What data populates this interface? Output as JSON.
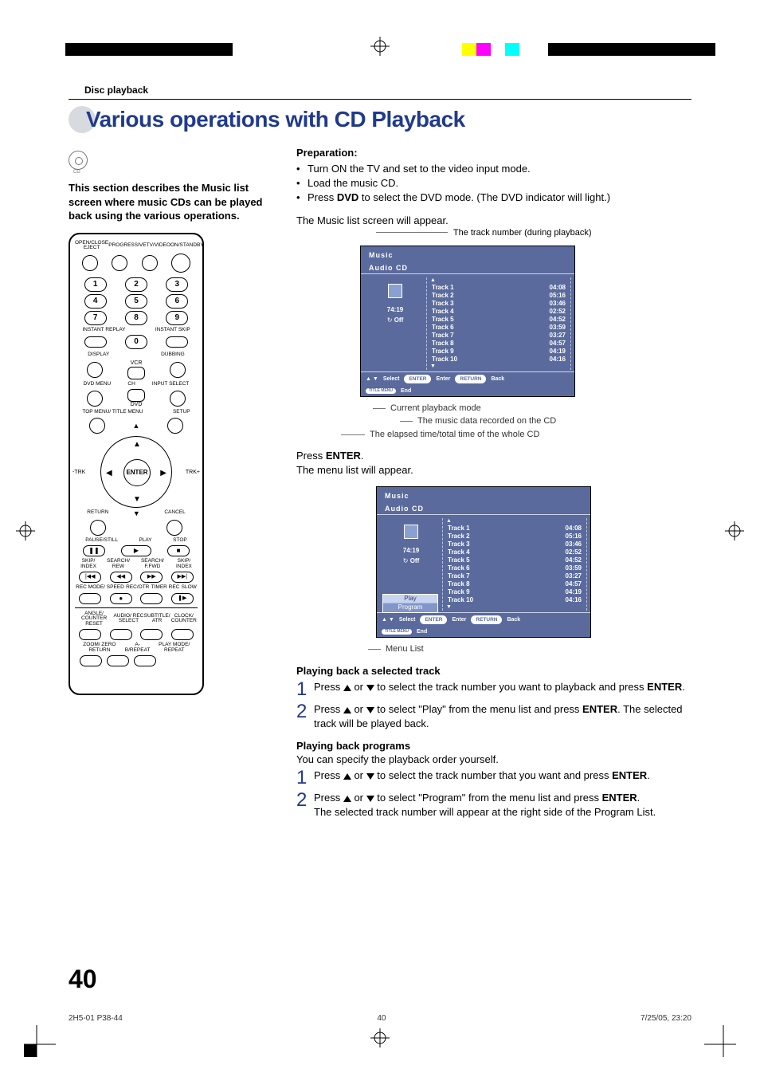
{
  "section_header": "Disc playback",
  "page_title": "Various operations with CD Playback",
  "cd_label": "CD",
  "intro": "This section describes the Music list screen where music CDs can be played back using the various operations.",
  "preparation": {
    "heading": "Preparation:",
    "bullets": [
      "Turn ON the TV and set to the video input mode.",
      "Load the music CD.",
      "Press DVD to select the DVD mode. (The DVD indicator will light.)"
    ],
    "bold_in_b3": "DVD"
  },
  "para_after_prep": "The Music list screen will appear.",
  "track_callout": "The track number (during playback)",
  "osd1": {
    "title": "Music",
    "subtitle": "Audio CD",
    "total": "74:19",
    "mode_label": "Off",
    "tracks": [
      {
        "n": "Track 1",
        "t": "04:08"
      },
      {
        "n": "Track 2",
        "t": "05:16"
      },
      {
        "n": "Track 3",
        "t": "03:46"
      },
      {
        "n": "Track 4",
        "t": "02:52"
      },
      {
        "n": "Track 5",
        "t": "04:52"
      },
      {
        "n": "Track 6",
        "t": "03:59"
      },
      {
        "n": "Track 7",
        "t": "03:27"
      },
      {
        "n": "Track 8",
        "t": "04:57"
      },
      {
        "n": "Track 9",
        "t": "04:19"
      },
      {
        "n": "Track 10",
        "t": "04:16"
      }
    ],
    "hints": {
      "select": "Select",
      "enter": "ENTER",
      "enter_lbl": "Enter",
      "return": "RETURN",
      "back": "Back",
      "title": "TITLE MENU",
      "end": "End"
    }
  },
  "callouts1": {
    "a": "Current playback mode",
    "b": "The music data recorded on the CD",
    "c": "The elapsed time/total time of the whole CD"
  },
  "press_enter_lead": "Press ",
  "press_enter_bold": "ENTER",
  "press_enter_tail": ".",
  "menu_will_appear": "The menu list will appear.",
  "osd2": {
    "menu_items": [
      "Play",
      "Program"
    ]
  },
  "menu_list_label": "Menu List",
  "sec_a": {
    "heading": "Playing back a selected track",
    "step1_a": "Press ",
    "step1_b": " or ",
    "step1_c": " to select the track number you want to playback and press ",
    "step1_bold": "ENTER",
    "step1_d": ".",
    "step2_a": "Press ",
    "step2_b": " or ",
    "step2_c": " to select \"Play\" from the menu list and press ",
    "step2_bold": "ENTER",
    "step2_d": ". The selected track will be played back."
  },
  "sec_b": {
    "heading": "Playing back programs",
    "intro": "You can specify the playback order yourself.",
    "step1_a": "Press ",
    "step1_b": " or ",
    "step1_c": " to select  the track number that you want and press ",
    "step1_bold": "ENTER",
    "step1_d": ".",
    "step2_a": "Press ",
    "step2_b": " or ",
    "step2_c": "  to select \"Program\" from the menu list and press ",
    "step2_bold": "ENTER",
    "step2_d": ".",
    "step2_e": "The selected track number will appear at the right side of the Program List."
  },
  "remote": {
    "row1_lbls": [
      "OPEN/CLOSE EJECT",
      "PROGRESSIVE",
      "TV/VIDEO",
      "ON/STANDBY"
    ],
    "instant_replay": "INSTANT REPLAY",
    "instant_skip": "INSTANT SKIP",
    "display": "DISPLAY",
    "dubbing": "DUBBING",
    "vcr": "VCR",
    "dvd": "DVD",
    "dvd_menu": "DVD MENU",
    "ch": "CH",
    "input": "INPUT SELECT",
    "top_menu": "TOP MENU/ TITLE MENU",
    "setup": "SETUP",
    "trk_minus": "-TRK",
    "trk_plus": "TRK+",
    "enter": "ENTER",
    "return": "RETURN",
    "cancel": "CANCEL",
    "pause": "PAUSE/STILL",
    "play": "PLAY",
    "stop": "STOP",
    "row_trans": [
      "SKIP/ INDEX",
      "SEARCH/ REW",
      "SEARCH/ F.FWD",
      "SKIP/ INDEX"
    ],
    "rec": "REC MODE/ SPEED",
    "recotr": "REC/OTR",
    "timer": "TIMER REC",
    "slow": "SLOW",
    "bottom1": [
      "ANGLE/ COUNTER RESET",
      "AUDIO/ REC SELECT",
      "SUBTITLE/ ATR",
      "CLOCK/ COUNTER"
    ],
    "bottom2": [
      "ZOOM/ ZERO RETURN",
      "A-B/REPEAT",
      "PLAY MODE/ REPEAT"
    ]
  },
  "page_number": "40",
  "footer": {
    "left": "2H5-01 P38-44",
    "center": "40",
    "right": "7/25/05, 23:20"
  }
}
